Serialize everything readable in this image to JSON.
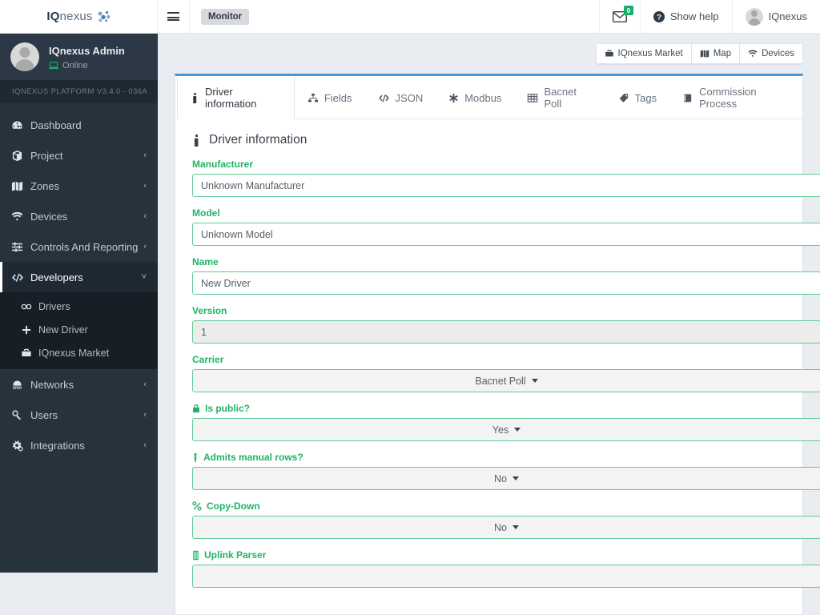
{
  "brand": {
    "prefix": "IQ",
    "suffix": "nexus",
    "mark": "network-nodes-icon"
  },
  "topbar": {
    "menu_toggle": "hamburger-icon",
    "page_badge": "Monitor",
    "mail_count": "0",
    "help_label": "Show help",
    "user_label": "IQnexus"
  },
  "sidebar": {
    "user": {
      "name": "IQnexus Admin",
      "status": "Online",
      "status_icon": "laptop-icon"
    },
    "version": "IQNEXUS PLATFORM V3.4.0 - 036A",
    "items": [
      {
        "label": "Dashboard",
        "icon": "dashboard-icon",
        "caret": "",
        "active": false
      },
      {
        "label": "Project",
        "icon": "box-icon",
        "caret": "‹",
        "active": false
      },
      {
        "label": "Zones",
        "icon": "map-icon",
        "caret": "‹",
        "active": false
      },
      {
        "label": "Devices",
        "icon": "wifi-icon",
        "caret": "‹",
        "active": false
      },
      {
        "label": "Controls And Reporting",
        "icon": "sliders-icon",
        "caret": "‹",
        "active": false
      },
      {
        "label": "Developers",
        "icon": "code-icon",
        "caret": "˅",
        "active": true
      }
    ],
    "sub_items": [
      {
        "label": "Drivers",
        "icon": "chain-icon"
      },
      {
        "label": "New Driver",
        "icon": "plus-icon"
      },
      {
        "label": "IQnexus Market",
        "icon": "briefcase-icon"
      }
    ],
    "items_after": [
      {
        "label": "Networks",
        "icon": "network-icon",
        "caret": "‹"
      },
      {
        "label": "Users",
        "icon": "user-key-icon",
        "caret": "‹"
      },
      {
        "label": "Integrations",
        "icon": "gears-icon",
        "caret": "‹"
      }
    ]
  },
  "toolbar": {
    "buttons": [
      {
        "label": "IQnexus Market",
        "icon": "briefcase-icon"
      },
      {
        "label": "Map",
        "icon": "map-icon"
      },
      {
        "label": "Devices",
        "icon": "wifi-icon"
      }
    ]
  },
  "tabs": [
    {
      "label": "Driver information",
      "icon": "info-icon",
      "active": true
    },
    {
      "label": "Fields",
      "icon": "sitemap-icon",
      "active": false
    },
    {
      "label": "JSON",
      "icon": "code-icon",
      "active": false
    },
    {
      "label": "Modbus",
      "icon": "asterisk-icon",
      "active": false
    },
    {
      "label": "Bacnet Poll",
      "icon": "table-icon",
      "active": false
    },
    {
      "label": "Tags",
      "icon": "tag-icon",
      "active": false
    },
    {
      "label": "Commission Process",
      "icon": "book-icon",
      "active": false
    }
  ],
  "form": {
    "section_title": "Driver information",
    "section_icon": "info-icon",
    "fields": [
      {
        "label": "Manufacturer",
        "icon": "",
        "value": "Unknown Manufacturer",
        "type": "text",
        "readonly": false
      },
      {
        "label": "Model",
        "icon": "",
        "value": "Unknown Model",
        "type": "text",
        "readonly": false
      },
      {
        "label": "Name",
        "icon": "",
        "value": "New Driver",
        "type": "text",
        "readonly": false
      },
      {
        "label": "Version",
        "icon": "",
        "value": "1",
        "type": "text",
        "readonly": true
      },
      {
        "label": "Carrier",
        "icon": "",
        "value": "Bacnet Poll",
        "type": "select",
        "readonly": false
      },
      {
        "label": "Is public?",
        "icon": "lock-icon",
        "value": "Yes",
        "type": "select",
        "readonly": false
      },
      {
        "label": "Admits manual rows?",
        "icon": "person-icon",
        "value": "No",
        "type": "select",
        "readonly": false
      },
      {
        "label": "Copy-Down",
        "icon": "percent-icon",
        "value": "No",
        "type": "select",
        "readonly": false
      },
      {
        "label": "Uplink Parser",
        "icon": "memory-icon",
        "value": "",
        "type": "select",
        "readonly": false
      }
    ]
  },
  "colors": {
    "accent_green": "#1eb563",
    "field_border": "#5fcb96",
    "tab_top_border": "#4298d6",
    "sidebar_bg": "#26323c",
    "page_bg": "#e9edf2"
  }
}
